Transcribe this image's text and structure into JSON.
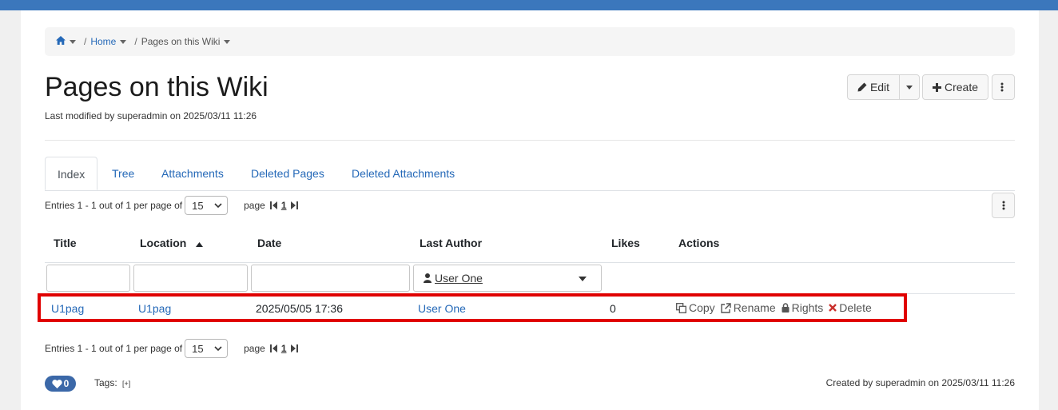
{
  "breadcrumb": {
    "home_label": "Home",
    "current_label": "Pages on this Wiki",
    "separator": "/"
  },
  "page": {
    "title": "Pages on this Wiki",
    "last_modified": "Last modified by superadmin on 2025/03/11 11:26"
  },
  "toolbar": {
    "edit_label": "Edit",
    "create_label": "Create"
  },
  "tabs": [
    {
      "label": "Index",
      "active": true
    },
    {
      "label": "Tree"
    },
    {
      "label": "Attachments"
    },
    {
      "label": "Deleted Pages"
    },
    {
      "label": "Deleted Attachments"
    }
  ],
  "pagination": {
    "entries_text": "Entries 1 - 1 out of 1 per page of",
    "per_page": "15",
    "page_label": "page",
    "current_page": "1"
  },
  "table": {
    "headers": {
      "title": "Title",
      "location": "Location",
      "date": "Date",
      "author": "Last Author",
      "likes": "Likes",
      "actions": "Actions"
    },
    "filter_author": "User One",
    "rows": [
      {
        "title": "U1pag",
        "location": "U1pag",
        "date": "2025/05/05 17:36",
        "author": "User One",
        "likes": "0"
      }
    ],
    "actions": {
      "copy": "Copy",
      "rename": "Rename",
      "rights": "Rights",
      "delete": "Delete"
    }
  },
  "footer": {
    "likes_count": "0",
    "tags_label": "Tags:",
    "tags_add": "[+]",
    "created": "Created by superadmin on 2025/03/11 11:26"
  },
  "colors": {
    "topbar": "#3b77bc",
    "link": "#2569b8",
    "highlight": "#e00000",
    "delete_icon": "#c9302c"
  }
}
